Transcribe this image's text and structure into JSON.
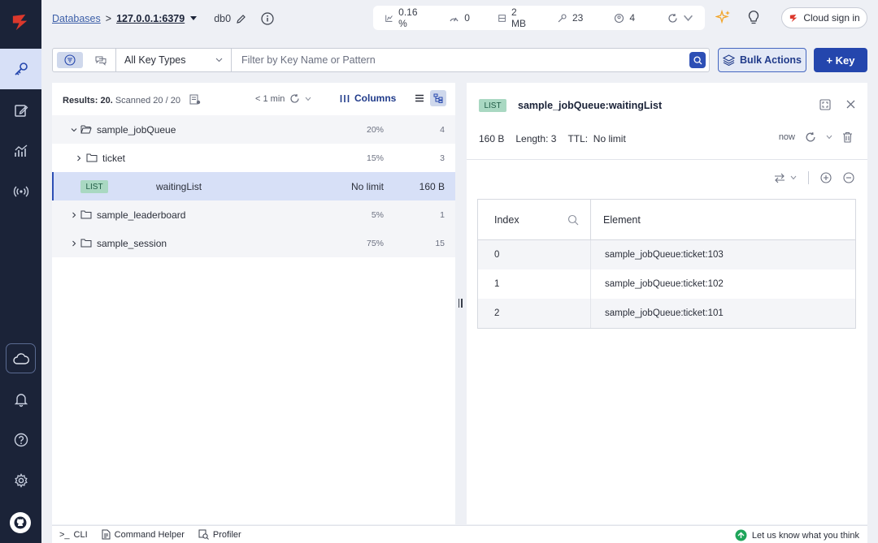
{
  "breadcrumb": {
    "databases_label": "Databases",
    "separator": ">",
    "host": "127.0.0.1:6379",
    "db": "db0"
  },
  "stats": [
    {
      "icon": "cpu-icon",
      "value": "0.16 %"
    },
    {
      "icon": "ops-icon",
      "value": "0"
    },
    {
      "icon": "memory-icon",
      "value": "2 MB"
    },
    {
      "icon": "key-icon",
      "value": "23"
    },
    {
      "icon": "clients-icon",
      "value": "4"
    }
  ],
  "header": {
    "cloud_signin_label": "Cloud sign in"
  },
  "filter": {
    "key_types_label": "All Key Types",
    "placeholder": "Filter by Key Name or Pattern"
  },
  "actions": {
    "bulk_label": "Bulk Actions",
    "add_key_label": "+ Key"
  },
  "list_header": {
    "results_label": "Results: 20.",
    "scanned_label": "Scanned 20 / 20",
    "refresh_label": "< 1 min",
    "columns_label": "Columns"
  },
  "tree": [
    {
      "name": "sample_jobQueue",
      "pct": "20%",
      "count": "4",
      "expanded": true
    },
    {
      "name": "ticket",
      "pct": "15%",
      "count": "3",
      "expanded": false
    },
    {
      "type": "LIST",
      "name": "waitingList",
      "ttl": "No limit",
      "size": "160 B"
    },
    {
      "name": "sample_leaderboard",
      "pct": "5%",
      "count": "1",
      "expanded": false
    },
    {
      "name": "sample_session",
      "pct": "75%",
      "count": "15",
      "expanded": false
    }
  ],
  "detail": {
    "type": "LIST",
    "key": "sample_jobQueue:waitingList",
    "size": "160 B",
    "length_label": "Length:",
    "length": "3",
    "ttl_label": "TTL:",
    "ttl": "No limit",
    "last_refresh": "now",
    "columns": {
      "index": "Index",
      "element": "Element"
    },
    "rows": [
      {
        "index": "0",
        "element": "sample_jobQueue:ticket:103"
      },
      {
        "index": "1",
        "element": "sample_jobQueue:ticket:102"
      },
      {
        "index": "2",
        "element": "sample_jobQueue:ticket:101"
      }
    ]
  },
  "bottom": {
    "cli": "CLI",
    "cli_prompt": ">_",
    "command_helper": "Command Helper",
    "profiler": "Profiler",
    "feedback": "Let us know what you think"
  },
  "colors": {
    "sidebar": "#1b2338",
    "primary": "#2446ad",
    "list_badge": "#a9d8c2",
    "selected_row": "#d7e0f7",
    "logo_red": "#dc382c"
  }
}
